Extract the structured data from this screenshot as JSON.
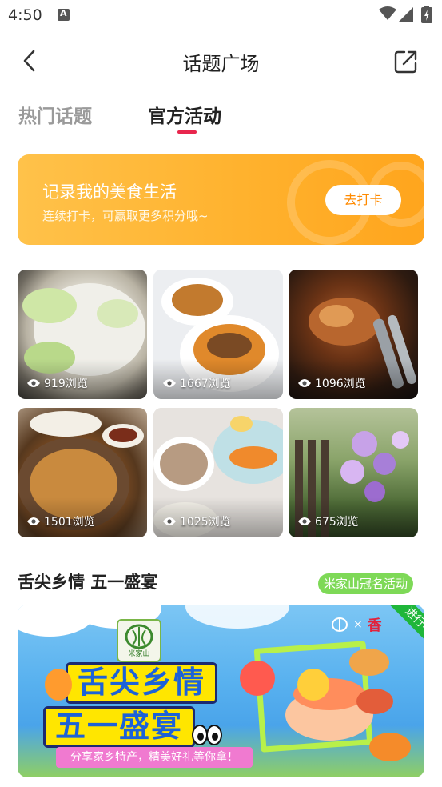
{
  "status_bar": {
    "time": "4:50",
    "icons": [
      "a-notification-icon",
      "wifi-icon",
      "signal-icon",
      "battery-icon"
    ]
  },
  "nav": {
    "title": "话题广场",
    "back_icon": "chevron-left-icon",
    "share_icon": "share-external-icon"
  },
  "tabs": [
    {
      "label": "热门话题",
      "active": false
    },
    {
      "label": "官方活动",
      "active": true
    }
  ],
  "banner": {
    "title": "记录我的美食生活",
    "subtitle": "连续打卡，可赢取更多积分哦~",
    "button_label": "去打卡"
  },
  "posts": [
    {
      "views": "919浏览",
      "subject": "noodle soup with greens"
    },
    {
      "views": "1667浏览",
      "subject": "braised chicken feet in bowls"
    },
    {
      "views": "1096浏览",
      "subject": "grilled meat with tongs"
    },
    {
      "views": "1501浏览",
      "subject": "stir-fried dish on plate"
    },
    {
      "views": "1025浏览",
      "subject": "breakfast plate with drink"
    },
    {
      "views": "675浏览",
      "subject": "purple flowers by fence"
    }
  ],
  "section": {
    "title": "舌尖乡情 五一盛宴",
    "tag": "米家山冠名活动"
  },
  "promo": {
    "logo_text": "米家山",
    "headline_1": "舌尖乡情",
    "headline_2": "五一盛宴",
    "share_text": "分享家乡特产，精美好礼等你拿！",
    "brand_partner": "香",
    "badge": "进行中",
    "colors": {
      "accent": "#e8264d",
      "banner": "#ffb22e",
      "tag": "#7ed957",
      "badge": "#1fb63a"
    }
  }
}
